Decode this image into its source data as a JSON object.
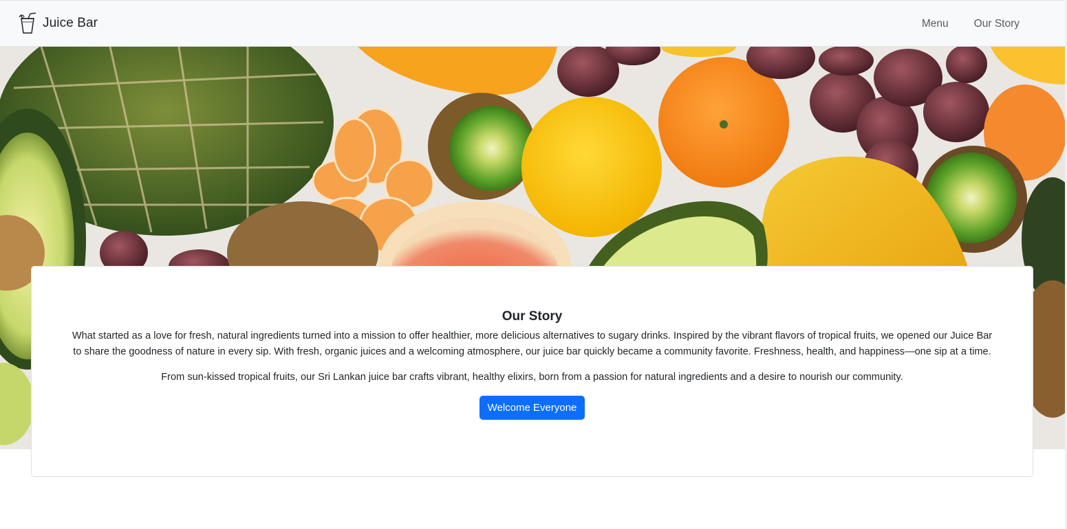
{
  "navbar": {
    "brand": "Juice Bar",
    "brand_icon": "juice-glass-icon",
    "links": [
      {
        "label": "Menu"
      },
      {
        "label": "Our Story"
      }
    ]
  },
  "hero": {
    "image": "tropical-fruits-photo"
  },
  "story": {
    "title": "Our Story",
    "paragraph1": "What started as a love for fresh, natural ingredients turned into a mission to offer healthier, more delicious alternatives to sugary drinks. Inspired by the vibrant flavors of tropical fruits, we opened our Juice Bar to share the goodness of nature in every sip. With fresh, organic juices and a welcoming atmosphere, our juice bar quickly became a community favorite. Freshness, health, and happiness—one sip at a time.",
    "paragraph2": "From sun-kissed tropical fruits, our Sri Lankan juice bar crafts vibrant, healthy elixirs, born from a passion for natural ingredients and a desire to nourish our community.",
    "button_label": "Welcome Everyone"
  },
  "colors": {
    "navbar_bg": "#f8f9fa",
    "primary": "#0d6efd"
  }
}
